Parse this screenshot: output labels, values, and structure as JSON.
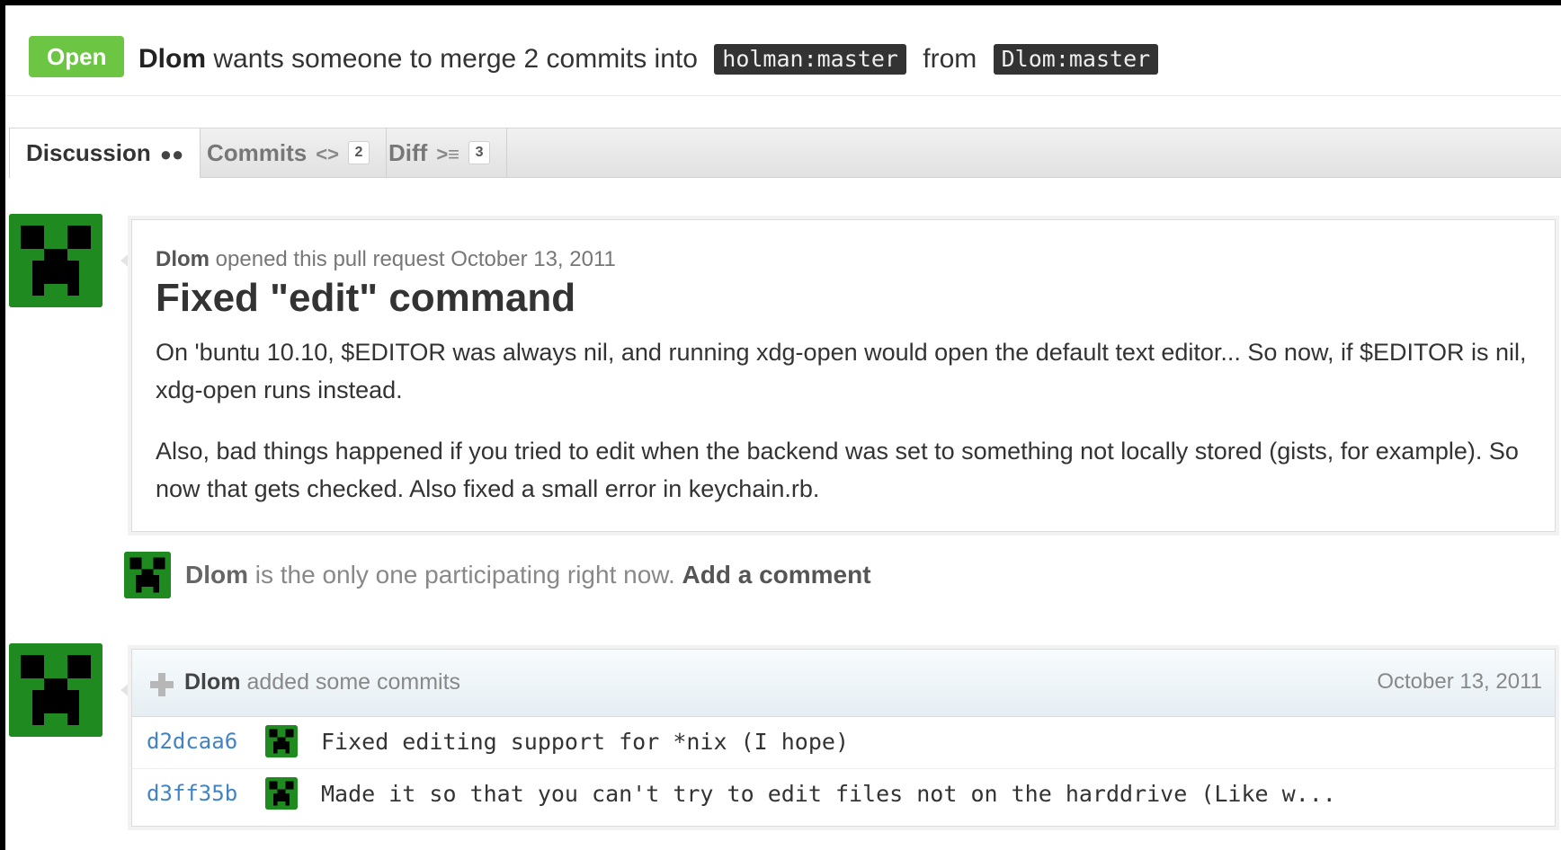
{
  "header": {
    "state": "Open",
    "author": "Dlom",
    "text_merge": "wants someone to merge 2 commits into",
    "base_ref": "holman:master",
    "text_from": "from",
    "head_ref": "Dlom:master"
  },
  "tabs": [
    {
      "label": "Discussion",
      "icon": "chat-bubbles-icon"
    },
    {
      "label": "Commits",
      "icon": "code-icon",
      "count": "2"
    },
    {
      "label": "Diff",
      "icon": "diff-icon",
      "count": "3"
    }
  ],
  "comment": {
    "author": "Dlom",
    "meta": "opened this pull request October 13, 2011",
    "title": "Fixed \"edit\" command",
    "paragraphs": [
      "On 'buntu 10.10, $EDITOR was always nil, and running xdg-open would open the default text editor... So now, if $EDITOR is nil, xdg-open runs instead.",
      "Also, bad things happened if you tried to edit when the backend was set to something not locally stored (gists, for example). So now that gets checked. Also fixed a small error in keychain.rb."
    ]
  },
  "participation": {
    "author": "Dlom",
    "text": "is the only one participating right now.",
    "add_comment": "Add a comment"
  },
  "commits": {
    "author": "Dlom",
    "title": "added some commits",
    "date": "October 13, 2011",
    "rows": [
      {
        "sha": "d2dcaa6",
        "message": "Fixed editing support for *nix (I hope)"
      },
      {
        "sha": "d3ff35b",
        "message": "Made it so that you can't try to edit files not on the harddrive (Like w..."
      }
    ]
  },
  "colors": {
    "open_green": "#6cc644",
    "link_blue": "#4183c4",
    "avatar_green": "#1f8a1f"
  }
}
